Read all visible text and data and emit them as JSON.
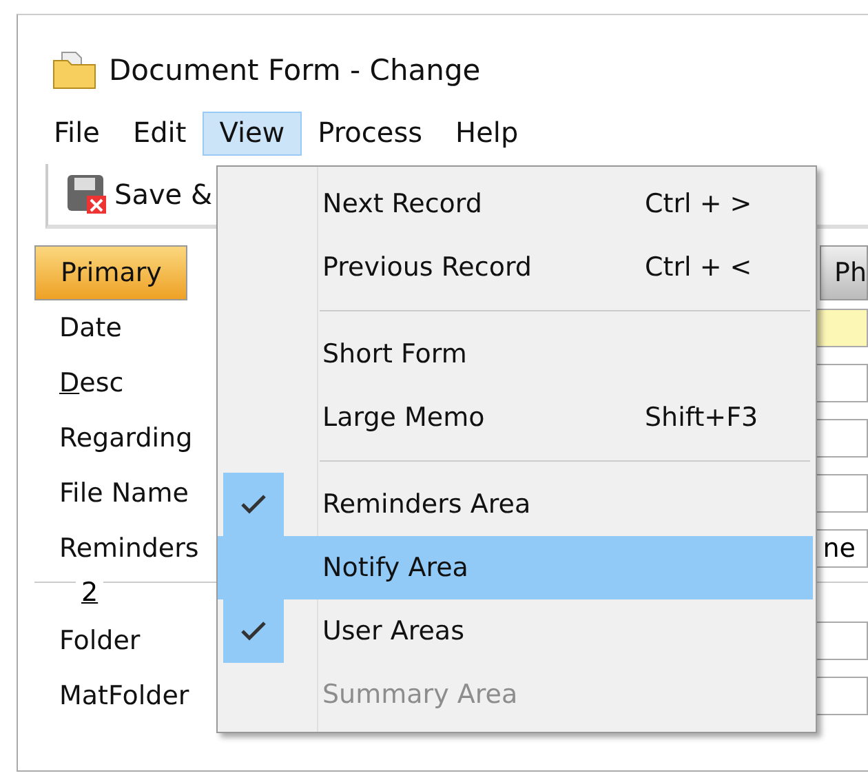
{
  "window": {
    "title": "Document Form - Change"
  },
  "menu_bar": [
    {
      "label": "File",
      "selected": false
    },
    {
      "label": "Edit",
      "selected": false
    },
    {
      "label": "View",
      "selected": true
    },
    {
      "label": "Process",
      "selected": false
    },
    {
      "label": "Help",
      "selected": false
    }
  ],
  "toolbar": {
    "save_button": "Save &"
  },
  "tabs": [
    {
      "label": "Primary",
      "selected": true
    },
    {
      "label": "Ph",
      "selected": false
    }
  ],
  "form": {
    "rows": [
      {
        "label": "Date",
        "mnemonic": false,
        "highlighted": true
      },
      {
        "label": "Desc",
        "mnemonic": true,
        "highlighted": false
      },
      {
        "label": "Regarding",
        "mnemonic": false,
        "highlighted": false
      },
      {
        "label": "File Name",
        "mnemonic": false,
        "highlighted": false
      },
      {
        "label": "Reminders",
        "mnemonic": false,
        "highlighted": false,
        "trailing": "ne"
      }
    ],
    "group_label": "2",
    "rows_2": [
      {
        "label": "Folder",
        "mnemonic": false,
        "highlighted": false
      },
      {
        "label": "MatFolder",
        "mnemonic": false,
        "highlighted": false
      }
    ]
  },
  "view_menu": {
    "groups": [
      [
        {
          "label": "Next Record",
          "shortcut": "Ctrl + >",
          "checked": false,
          "selected": false,
          "disabled": false
        },
        {
          "label": "Previous Record",
          "shortcut": "Ctrl + <",
          "checked": false,
          "selected": false,
          "disabled": false
        }
      ],
      [
        {
          "label": "Short Form",
          "checked": false,
          "selected": false,
          "disabled": false
        },
        {
          "label": "Large Memo",
          "shortcut": "Shift+F3",
          "checked": false,
          "selected": false,
          "disabled": false
        }
      ],
      [
        {
          "label": "Reminders Area",
          "checked": true,
          "selected": false,
          "disabled": false
        },
        {
          "label": "Notify Area",
          "checked": false,
          "selected": true,
          "disabled": false
        },
        {
          "label": "User Areas",
          "checked": true,
          "selected": false,
          "disabled": false
        },
        {
          "label": "Summary Area",
          "checked": false,
          "selected": false,
          "disabled": true
        }
      ]
    ]
  }
}
